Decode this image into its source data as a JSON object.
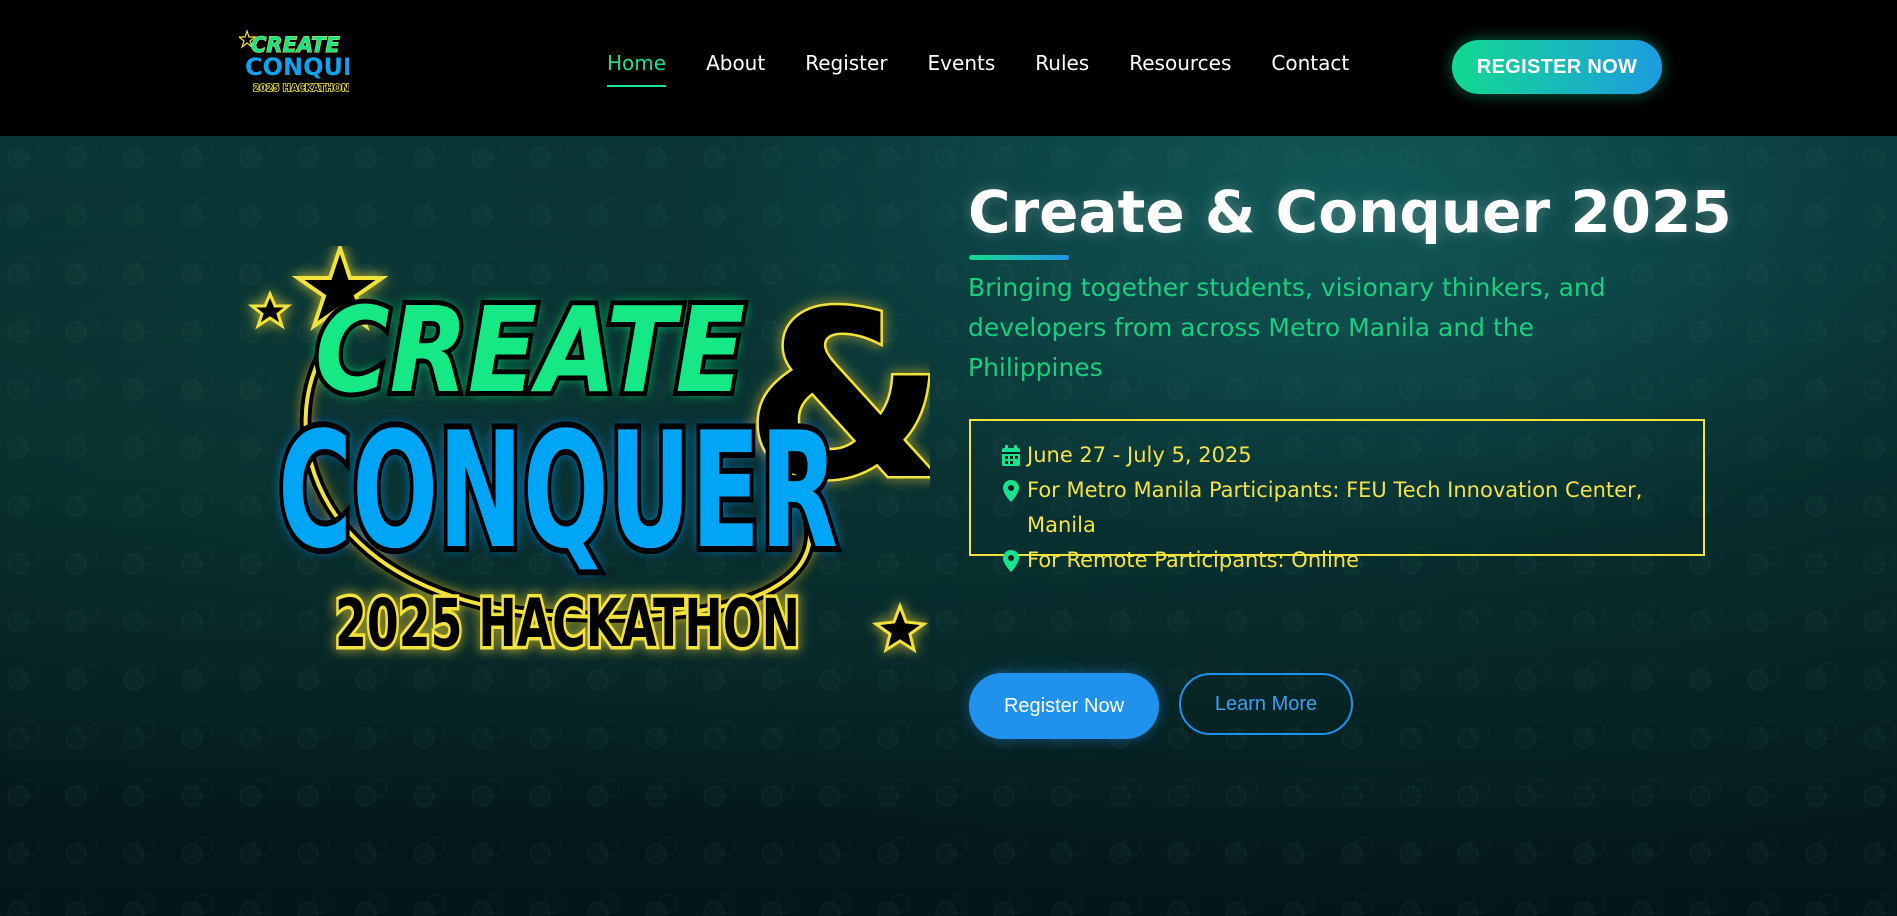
{
  "colors": {
    "accent_green": "#17e38e",
    "accent_blue": "#2191ee",
    "info_yellow": "#f2e23c",
    "header_bg": "#000000"
  },
  "header": {
    "logo_icon": "create-and-conquer-logo",
    "logo_text": {
      "line1": "CREATE",
      "line2": "CONQUER",
      "line3": "2025 HACKATHON"
    },
    "nav": [
      {
        "label": "Home",
        "active": true
      },
      {
        "label": "About",
        "active": false
      },
      {
        "label": "Register",
        "active": false
      },
      {
        "label": "Events",
        "active": false
      },
      {
        "label": "Rules",
        "active": false
      },
      {
        "label": "Resources",
        "active": false
      },
      {
        "label": "Contact",
        "active": false
      }
    ],
    "cta_label": "REGISTER NOW"
  },
  "hero": {
    "logo_icon": "create-and-conquer-hackathon-logo",
    "logo_text": {
      "line1": "CREATE",
      "ampersand": "&",
      "line2": "CONQUER",
      "line3": "2025 HACKATHON"
    },
    "title": "Create & Conquer 2025",
    "subtitle": "Bringing together students, visionary thinkers, and developers from across Metro Manila and the Philippines",
    "info": [
      {
        "icon": "calendar-icon",
        "text": "June 27 - July 5, 2025"
      },
      {
        "icon": "map-pin-icon",
        "text": "For Metro Manila Participants: FEU Tech Innovation Center, Manila"
      },
      {
        "icon": "map-pin-icon",
        "text": "For Remote Participants: Online"
      }
    ],
    "primary_button": "Register Now",
    "secondary_button": "Learn More"
  }
}
